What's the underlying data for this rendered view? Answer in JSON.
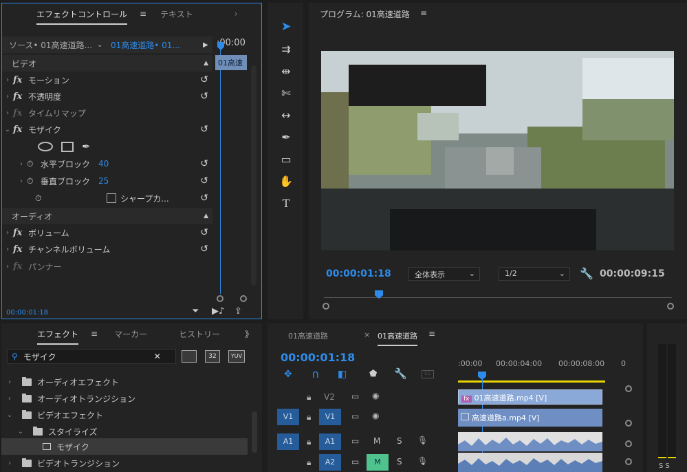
{
  "effect_controls": {
    "tab_active": "エフェクトコントロール",
    "tab_text": "テキスト",
    "more": "》",
    "source_label": "ソース• 01高速道路...",
    "clip_label": "01高速道路• 01...",
    "time_ruler": ":00:00",
    "clip_block": "01高速",
    "video_header": "ビデオ",
    "audio_header": "オーディオ",
    "items": {
      "motion": "モーション",
      "opacity": "不透明度",
      "time_remap": "タイムリマップ",
      "mosaic": "モザイク",
      "h_blocks_label": "水平ブロック",
      "h_blocks_value": "40",
      "v_blocks_label": "垂直ブロック",
      "v_blocks_value": "25",
      "sharp": "シャープカ...",
      "volume": "ボリューム",
      "channel_volume": "チャンネルボリューム",
      "panner": "パンナー"
    },
    "timecode": "00:00:01:18"
  },
  "program": {
    "title": "プログラム: 01高速道路",
    "timecode": "00:00:01:18",
    "zoom": "全体表示",
    "resolution": "1/2",
    "duration": "00:00:09:15",
    "playhead_fraction": 0.18
  },
  "effects_panel": {
    "tab_effects": "エフェクト",
    "tab_markers": "マーカー",
    "tab_history": "ヒストリー",
    "more": "》",
    "search_value": "モザイク",
    "badge_32": "32",
    "badge_yuv": "YUV",
    "tree": [
      "オーディオエフェクト",
      "オーディオトランジション",
      "ビデオエフェクト",
      "スタイライズ",
      "モザイク",
      "ビデオトランジション"
    ]
  },
  "timeline": {
    "tab1": "01高速道路",
    "tab2": "01高速道路",
    "close": "×",
    "timecode": "00:00:01:18",
    "ruler": [
      ":00:00",
      "00:00:04:00",
      "00:00:08:00",
      "0"
    ],
    "tracks": {
      "v2": "V2",
      "v1_src": "V1",
      "v1": "V1",
      "a1_src": "A1",
      "a1": "A1",
      "a2": "A2",
      "m": "M",
      "s": "S"
    },
    "clip_v2": "01高速道路.mp4 [V]",
    "clip_v1": "高速道路a.mp4 [V]",
    "clip_v2_badge": "fx"
  },
  "meter": {
    "labels": "S S"
  }
}
